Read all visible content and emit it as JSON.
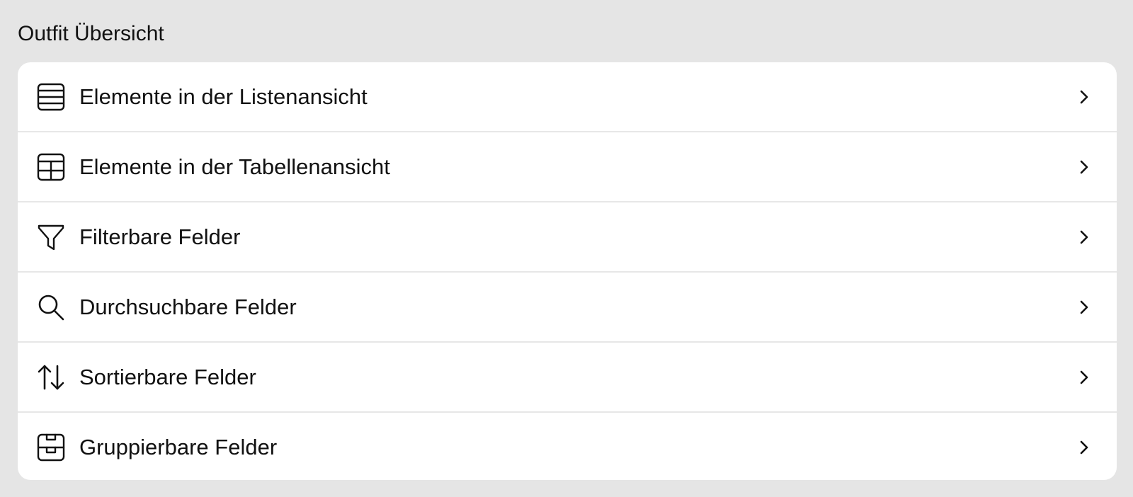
{
  "section": {
    "title": "Outfit Übersicht"
  },
  "items": [
    {
      "label": "Elemente in der Listenansicht",
      "icon": "list-view-icon"
    },
    {
      "label": "Elemente in der Tabellenansicht",
      "icon": "table-view-icon"
    },
    {
      "label": "Filterbare Felder",
      "icon": "filter-icon"
    },
    {
      "label": "Durchsuchbare Felder",
      "icon": "search-icon"
    },
    {
      "label": "Sortierbare Felder",
      "icon": "sort-arrows-icon"
    },
    {
      "label": "Gruppierbare Felder",
      "icon": "archive-box-icon"
    }
  ],
  "colors": {
    "background": "#e5e5e5",
    "card": "#ffffff",
    "text": "#111111",
    "divider": "#e7e7e7"
  }
}
